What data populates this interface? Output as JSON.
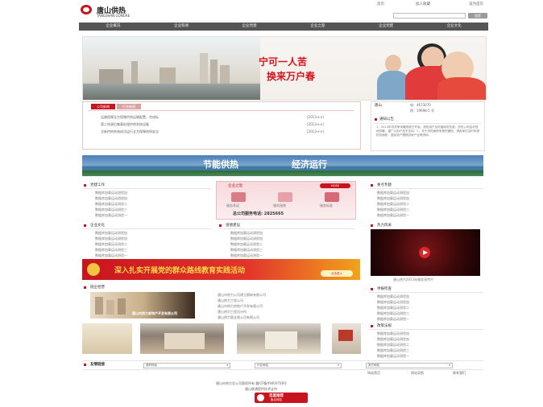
{
  "header": {
    "logo_cn": "唐山供热",
    "logo_en": "TANGSHAN GONGRE",
    "top_links": [
      "首页",
      "加入收藏",
      "设为首页"
    ],
    "search_button": "搜索"
  },
  "nav": [
    "企业概况",
    "企业新闻",
    "企业党建",
    "企业之窗",
    "企业党建",
    "企业文化"
  ],
  "banner": {
    "slogan_1": "宁可一人苦",
    "slogan_2": "换来万户春"
  },
  "news": {
    "tabs": [
      "公司新闻",
      "行业新闻"
    ],
    "items": [
      {
        "title": "运输保障全力保障供热运输配置，完成标",
        "date": "[2013-x-x]"
      },
      {
        "title": "第二热源后集事处理供热系统设备",
        "date": "[2013-x-x]"
      },
      {
        "title": "全新供热系统成功运行全力保障热网安全",
        "date": "[2013-x-x]"
      }
    ]
  },
  "contact": {
    "name": "唐山",
    "line1": "电：4673070",
    "line2": "热：19698-5 号",
    "notice_title": "通知公告",
    "notice_text": "1、2013年供热季采暖收费已开始，请热用户及时缴纳供热费，供热公司会尽快地供暖，望广大用户给予支持。2、关于供热面积申报的通知，请各单位及时申报供热面积，居民用户需提供房产证等资料。"
  },
  "banner2": {
    "slogan_1": "节能供热",
    "slogan_2": "经济运行"
  },
  "sections": {
    "party": {
      "title": "党建工作",
      "items": [
        "数据库加载运动测验加",
        "数据库加载运动测验加",
        "数据库加载运动测验二",
        "数据库加载运动测验三",
        "数据库加载运动测验一"
      ]
    },
    "window": {
      "title": "企业之窗",
      "more": "MORE",
      "icons": [
        "服务承诺",
        "服务指南",
        "服务标准"
      ],
      "hotline": "总公司服务电话: 2825665"
    },
    "focus": {
      "title": "要点专题",
      "items": [
        "数据库加载运动测验加",
        "数据库加载运动测验加",
        "数据库加载运动测验二",
        "数据库加载运动测验三",
        "数据库加载运动测验一"
      ]
    },
    "culture": {
      "title": "企业文化",
      "items": [
        "数据库加载运动测验加",
        "数据库加载运动测验加",
        "数据库加载运动测验二",
        "数据库加载运动测验三",
        "数据库加载运动测验一"
      ]
    },
    "build": {
      "title": "道德建设",
      "items": [
        "数据库加载运动测验加",
        "数据库加载运动测验加",
        "数据库加载运动测验二",
        "数据库加载运动测验三",
        "数据库加载运动测验一"
      ]
    },
    "video": {
      "title": "热力风采",
      "caption": "唐山热力2013年服务宣传片"
    },
    "red_banner": {
      "text": "深入扎实开展党的群众路线教育实践活动",
      "button": "点击进入"
    },
    "chain": {
      "title": "链企经营",
      "ad_text": "唐山市热力房地产开发有限公司",
      "items": [
        "唐山市热力公司建立都新有限公司",
        "唐山热力工程公司",
        "唐山市热力房地产开发有限公司",
        "唐山热力工程设计所",
        "唐山热力管业限公司有限公司"
      ]
    },
    "hotline": {
      "title": "举报检查",
      "items": [
        "数据库加载运动测验加",
        "数据库加载运动测验加",
        "数据库加载运动测验二",
        "数据库加载运动测验三",
        "数据库加载运动测验一"
      ]
    },
    "policy": {
      "title": "政策法规",
      "items": [
        "数据库加载运动测验加",
        "数据库加载运动测验加",
        "数据库加载运动测验二",
        "数据库加载运动测验三",
        "数据库加载运动测验一"
      ]
    }
  },
  "links": {
    "title": "友情链接",
    "selects": [
      "政府网站",
      "行业网站",
      "其它网站"
    ]
  },
  "footer": {
    "links": [
      "网站首页",
      "网站导航",
      "联系我们"
    ],
    "line1": "唐山市热力总公司版权所有 冀ICP备09000708号",
    "line2": "唐山联通提供技术支持",
    "badge": "百度推荐",
    "badge_sub": "聚合网站"
  },
  "colors": {
    "brand_red": "#c8141e",
    "nav_gray": "#555555"
  }
}
